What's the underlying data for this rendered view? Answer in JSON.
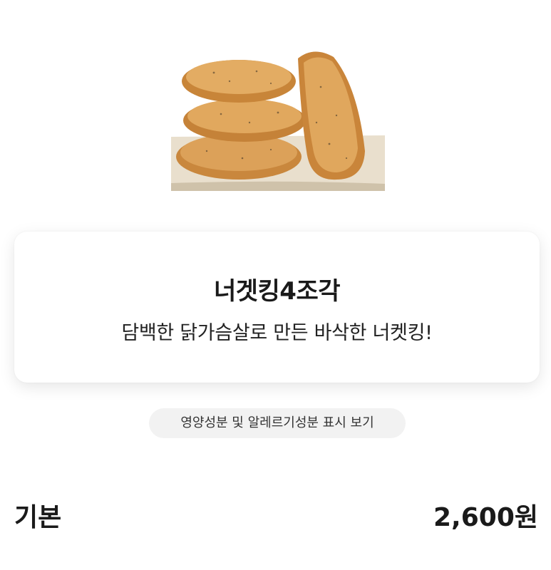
{
  "product": {
    "image_icon": "chicken-nuggets-image",
    "name": "너겟킹4조각",
    "description": "담백한 닭가슴살로 만든 바삭한 너켓킹!"
  },
  "nutrition_button": {
    "label": "영양성분 및 알레르기성분 표시 보기"
  },
  "option": {
    "label": "기본",
    "price": "2,600원"
  }
}
